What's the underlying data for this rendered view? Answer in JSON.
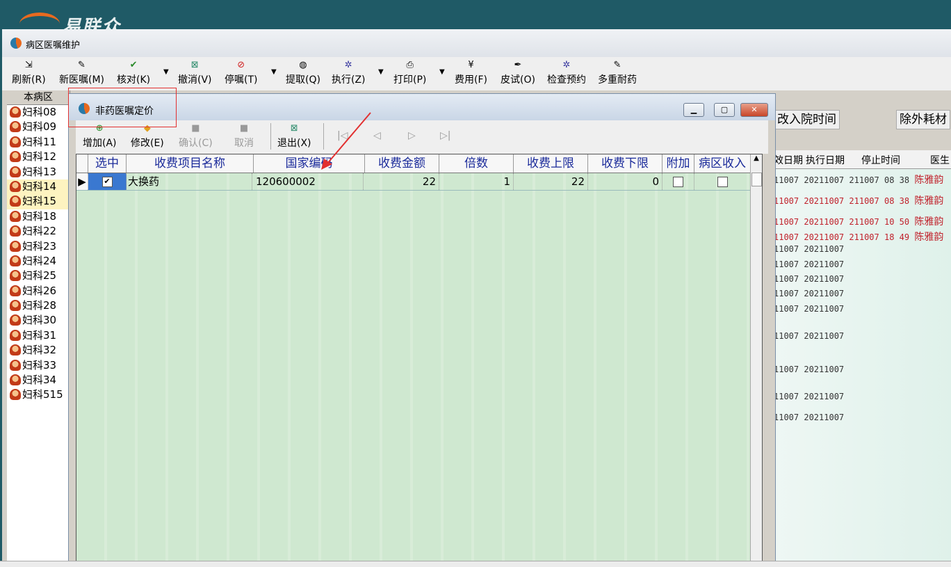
{
  "banner": {
    "logo_text": "易联众"
  },
  "main_window": {
    "title": "病区医嘱维护"
  },
  "toolbar": [
    {
      "label": "刷新(R)",
      "icon": "refresh-icon"
    },
    {
      "label": "新医嘱(M)",
      "icon": "new-order-icon"
    },
    {
      "label": "核对(K)",
      "icon": "check-icon"
    },
    {
      "label": "撤消(V)",
      "icon": "undo-icon"
    },
    {
      "label": "停嘱(T)",
      "icon": "stop-icon"
    },
    {
      "label": "提取(Q)",
      "icon": "extract-icon"
    },
    {
      "label": "执行(Z)",
      "icon": "execute-icon"
    },
    {
      "label": "打印(P)",
      "icon": "print-icon"
    },
    {
      "label": "费用(F)",
      "icon": "fee-icon"
    },
    {
      "label": "皮试(O)",
      "icon": "skin-test-icon"
    },
    {
      "label": "检查预约",
      "icon": "exam-appointment-icon"
    },
    {
      "label": "多重耐药",
      "icon": "multi-drug-resistance-icon"
    }
  ],
  "left_pane": {
    "header": "本病区",
    "patients": [
      "妇科08",
      "妇科09",
      "妇科11",
      "妇科12",
      "妇科13",
      "妇科14",
      "妇科15",
      "妇科18",
      "妇科22",
      "妇科23",
      "妇科24",
      "妇科25",
      "妇科26",
      "妇科28",
      "妇科30",
      "妇科31",
      "妇科32",
      "妇科33",
      "妇科34",
      "妇科515"
    ]
  },
  "right_pane": {
    "buttons": [
      "改入院时间",
      "除外耗材"
    ],
    "headers": [
      "效日期",
      "执行日期",
      "停止时间",
      "医生"
    ],
    "rows": [
      {
        "a": "11007",
        "b": "20211007",
        "c": "211007 08 38",
        "d": "陈雅韵",
        "red": false
      },
      {
        "a": "11007",
        "b": "20211007",
        "c": "211007 08 38",
        "d": "陈雅韵",
        "red": true
      },
      {
        "a": "11007",
        "b": "20211007",
        "c": "211007 10 50",
        "d": "陈雅韵",
        "red": true
      },
      {
        "a": "11007",
        "b": "20211007",
        "c": "211007 18 49",
        "d": "陈雅韵",
        "red": true
      },
      {
        "a": "11007",
        "b": "20211007",
        "c": "",
        "d": "",
        "red": false
      },
      {
        "a": "11007",
        "b": "20211007",
        "c": "",
        "d": "",
        "red": false
      },
      {
        "a": "11007",
        "b": "20211007",
        "c": "",
        "d": "",
        "red": false
      },
      {
        "a": "11007",
        "b": "20211007",
        "c": "",
        "d": "",
        "red": false
      },
      {
        "a": "11007",
        "b": "20211007",
        "c": "",
        "d": "",
        "red": false
      },
      {
        "a": "11007",
        "b": "20211007",
        "c": "",
        "d": "",
        "red": false
      },
      {
        "a": "11007",
        "b": "20211007",
        "c": "",
        "d": "",
        "red": false
      },
      {
        "a": "11007",
        "b": "20211007",
        "c": "",
        "d": "",
        "red": false
      },
      {
        "a": "11007",
        "b": "20211007",
        "c": "",
        "d": "",
        "red": false
      }
    ]
  },
  "dialog": {
    "title": "非药医嘱定价",
    "toolbar": [
      {
        "label": "增加(A)",
        "icon": "add-icon",
        "enabled": true
      },
      {
        "label": "修改(E)",
        "icon": "edit-icon",
        "enabled": true
      },
      {
        "label": "确认(C)",
        "icon": "confirm-icon",
        "enabled": false
      },
      {
        "label": "取消",
        "icon": "cancel-icon",
        "enabled": false
      },
      {
        "label": "退出(X)",
        "icon": "exit-icon",
        "enabled": true
      }
    ],
    "nav": [
      "|◁",
      "◁",
      "▷",
      "▷|"
    ],
    "columns": [
      "选中",
      "收费项目名称",
      "国家编码",
      "收费金额",
      "倍数",
      "收费上限",
      "收费下限",
      "附加",
      "病区收入"
    ],
    "rows": [
      {
        "selected": true,
        "name": "大换药",
        "code": "120600002",
        "amount": "22",
        "multiple": "1",
        "upper": "22",
        "lower": "0",
        "extra": false,
        "ward_income": false
      }
    ]
  },
  "colors": {
    "grid_bg": "#cfe8d0",
    "header_text": "#1a2a9a",
    "annotation": "#e23030",
    "doctor_text": "#c0202a"
  }
}
